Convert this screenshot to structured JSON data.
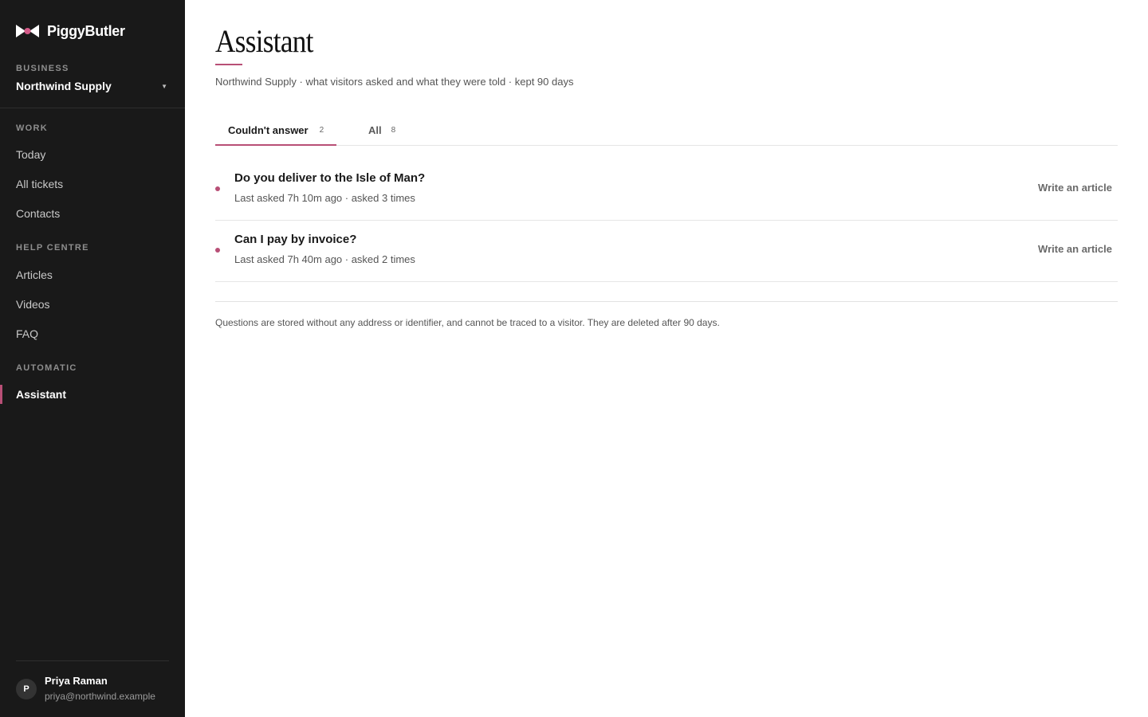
{
  "app": {
    "name": "PiggyButler"
  },
  "sidebar": {
    "business_label": "BUSINESS",
    "business_name": "Northwind Supply",
    "sections": [
      {
        "label": "WORK",
        "items": [
          {
            "label": "Today"
          },
          {
            "label": "All tickets"
          },
          {
            "label": "Contacts"
          }
        ]
      },
      {
        "label": "HELP CENTRE",
        "items": [
          {
            "label": "Articles"
          },
          {
            "label": "Videos"
          },
          {
            "label": "FAQ"
          }
        ]
      },
      {
        "label": "AUTOMATIC",
        "items": [
          {
            "label": "Assistant",
            "active": true
          }
        ]
      }
    ],
    "user": {
      "initial": "P",
      "name": "Priya Raman",
      "email": "priya@northwind.example"
    }
  },
  "main": {
    "title": "Assistant",
    "subtitle": "Northwind Supply · what visitors asked and what they were told · kept 90 days",
    "tabs": [
      {
        "label": "Couldn't answer",
        "count": "2",
        "active": true
      },
      {
        "label": "All",
        "count": "8",
        "active": false
      }
    ],
    "questions": [
      {
        "title": "Do you deliver to the Isle of Man?",
        "meta": "Last asked 7h 10m ago · asked 3 times",
        "action": "Write an article"
      },
      {
        "title": "Can I pay by invoice?",
        "meta": "Last asked 7h 40m ago · asked 2 times",
        "action": "Write an article"
      }
    ],
    "footer_note": "Questions are stored without any address or identifier, and cannot be traced to a visitor. They are deleted after 90 days."
  },
  "colors": {
    "sidebar_bg": "#191919",
    "accent": "#b84f76",
    "text": "#1a1a1a",
    "muted": "#555555"
  },
  "icons": {
    "logo": "bowtie-logo-icon",
    "business_caret": "caret-down-icon"
  }
}
